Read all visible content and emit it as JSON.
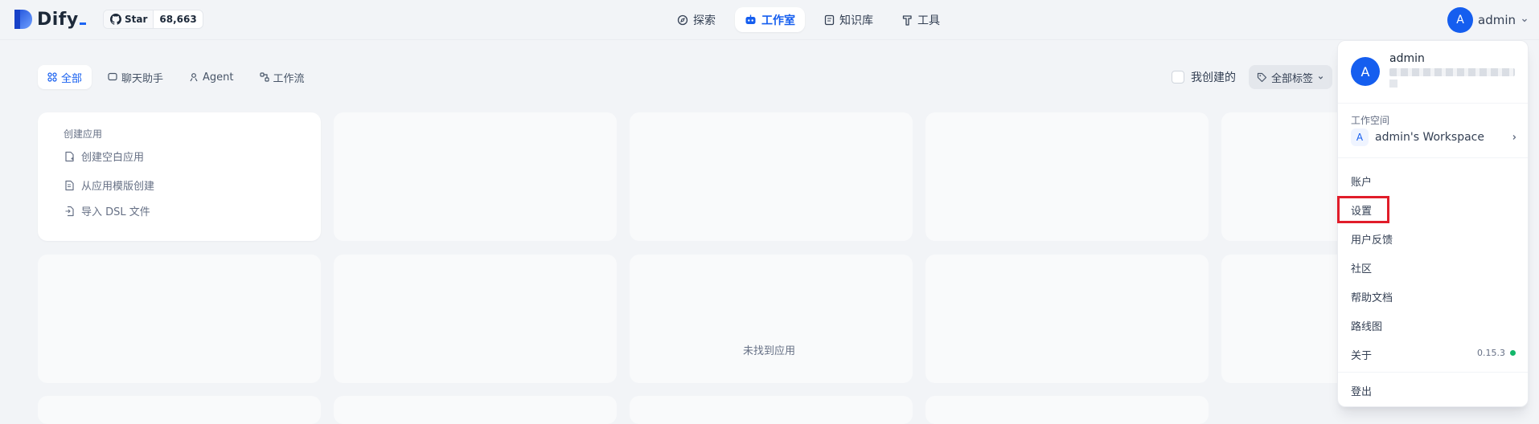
{
  "header": {
    "logo_text": "Dify",
    "github": {
      "star_label": "Star",
      "count": "68,663"
    },
    "nav": [
      {
        "label": "探索",
        "icon": "compass-icon"
      },
      {
        "label": "工作室",
        "icon": "robot-icon",
        "active": true
      },
      {
        "label": "知识库",
        "icon": "book-icon"
      },
      {
        "label": "工具",
        "icon": "hammer-icon"
      }
    ],
    "user": {
      "avatar_letter": "A",
      "name": "admin"
    }
  },
  "filters": {
    "tabs": [
      {
        "label": "全部",
        "icon": "grid-icon",
        "active": true
      },
      {
        "label": "聊天助手",
        "icon": "chat-icon"
      },
      {
        "label": "Agent",
        "icon": "agent-icon"
      },
      {
        "label": "工作流",
        "icon": "workflow-icon"
      }
    ],
    "mine_label": "我创建的",
    "tags_label": "全部标签"
  },
  "create_card": {
    "title": "创建应用",
    "items": [
      {
        "label": "创建空白应用",
        "icon": "blank-file-icon"
      },
      {
        "label": "从应用模版创建",
        "icon": "template-icon"
      },
      {
        "label": "导入 DSL 文件",
        "icon": "import-icon"
      }
    ]
  },
  "empty_text": "未找到应用",
  "dropdown": {
    "avatar_letter": "A",
    "name": "admin",
    "workspace_label": "工作空间",
    "workspace": {
      "badge": "A",
      "name": "admin's Workspace"
    },
    "items": [
      "账户",
      "设置",
      "用户反馈",
      "社区",
      "帮助文档",
      "路线图",
      "关于"
    ],
    "version": "0.15.3",
    "logout": "登出"
  },
  "colors": {
    "accent": "#155eef",
    "highlight": "#e11d2a",
    "status": "#12b76a"
  }
}
